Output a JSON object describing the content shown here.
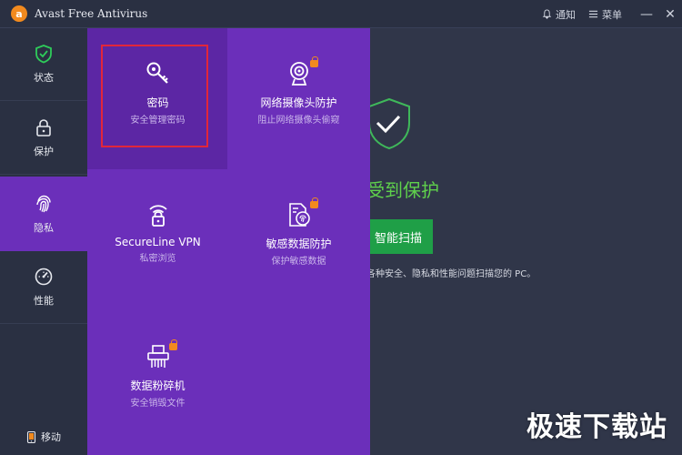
{
  "app": {
    "title": "Avast Free Antivirus",
    "logo_glyph": "a",
    "notify_label": "通知",
    "menu_label": "菜单",
    "minimize_glyph": "—",
    "close_glyph": "✕"
  },
  "sidebar": {
    "items": [
      {
        "label": "状态",
        "icon": "shield-check-icon",
        "active": false
      },
      {
        "label": "保护",
        "icon": "lock-icon",
        "active": false
      },
      {
        "label": "隐私",
        "icon": "fingerprint-icon",
        "active": true
      },
      {
        "label": "性能",
        "icon": "speedometer-icon",
        "active": false
      }
    ],
    "mobile_label": "移动"
  },
  "privacy_menu": {
    "tiles": [
      {
        "title": "密码",
        "subtitle": "安全管理密码",
        "icon": "key-icon",
        "locked": false
      },
      {
        "title": "网络摄像头防护",
        "subtitle": "阻止网络摄像头偷窥",
        "icon": "webcam-icon",
        "locked": true
      },
      {
        "title": "SecureLine VPN",
        "subtitle": "私密浏览",
        "icon": "wifi-lock-icon",
        "locked": false
      },
      {
        "title": "敏感数据防护",
        "subtitle": "保护敏感数据",
        "icon": "document-fingerprint-icon",
        "locked": true
      },
      {
        "title": "数据粉碎机",
        "subtitle": "安全销毁文件",
        "icon": "shredder-icon",
        "locked": true
      }
    ]
  },
  "main": {
    "status_text": "受到保护",
    "scan_button": "智能扫描",
    "description": "各种安全、隐私和性能问题扫描您的 PC。"
  },
  "watermark": "极速下载站",
  "colors": {
    "accent_purple": "#6b2fba",
    "selected_tile": "#5c26a4",
    "sidebar_bg": "#2a3042",
    "main_bg": "#303649",
    "status_green": "#5fd04c",
    "scan_green": "#1f9f47",
    "lock_orange": "#f28a1e",
    "highlight_red": "#e2263a"
  }
}
